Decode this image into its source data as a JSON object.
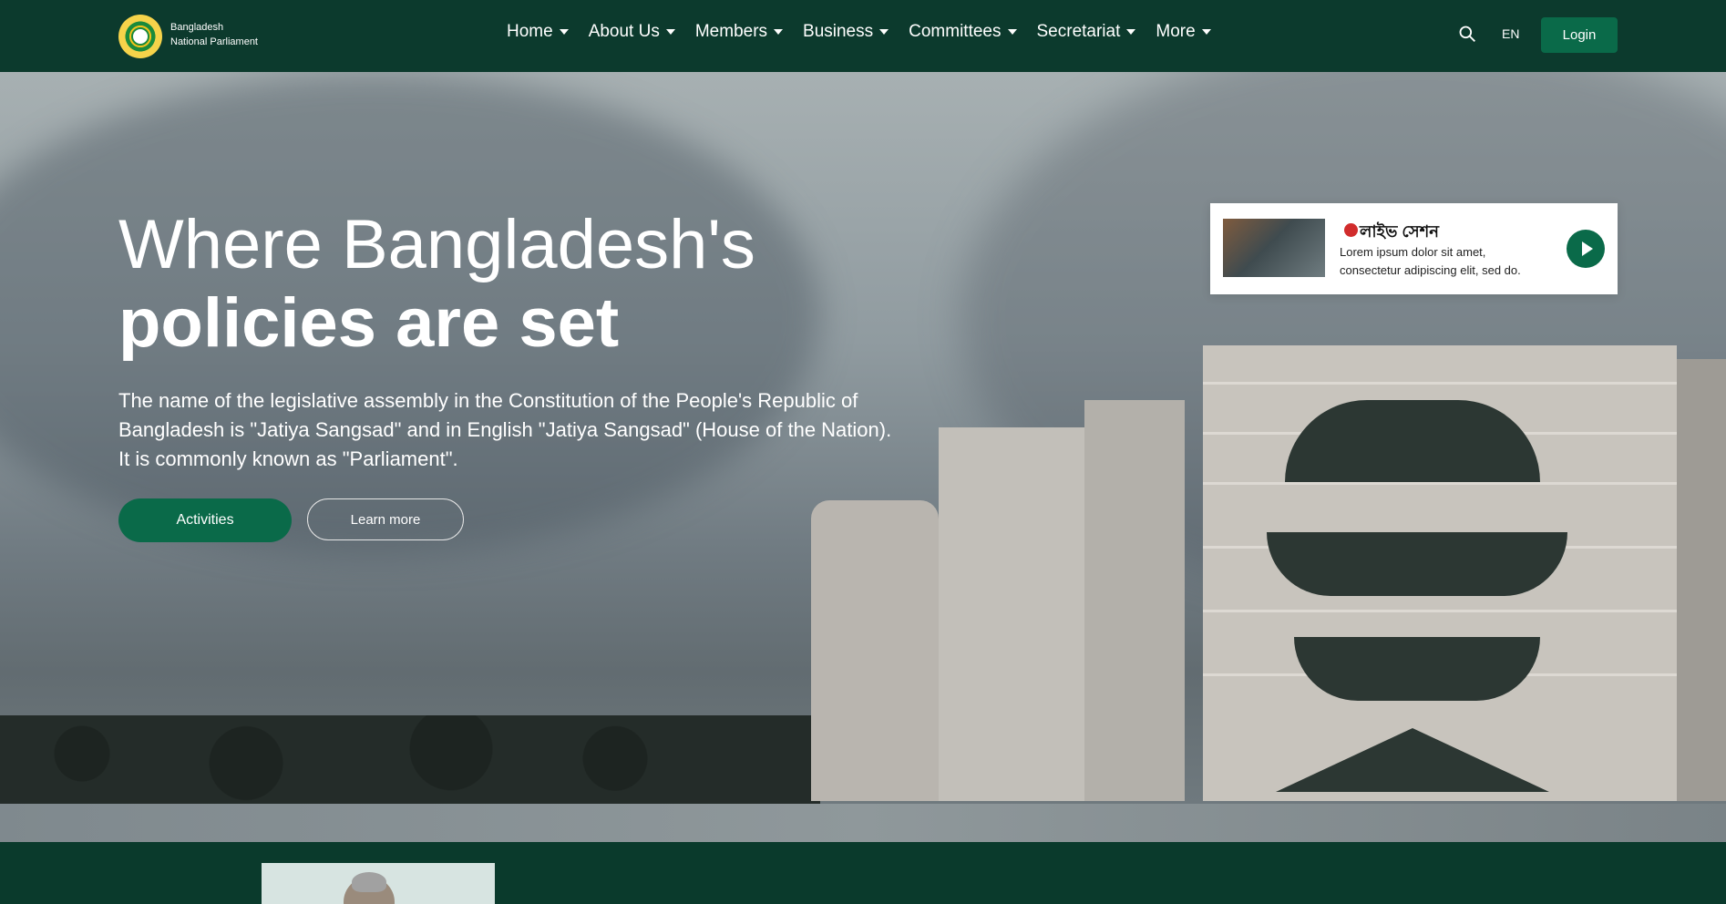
{
  "header": {
    "brand": {
      "line1": "Bangladesh",
      "line2": "National Parliament"
    },
    "nav": [
      {
        "label": "Home"
      },
      {
        "label": "About Us"
      },
      {
        "label": "Members"
      },
      {
        "label": "Business"
      },
      {
        "label": "Committees"
      },
      {
        "label": "Secretariat"
      },
      {
        "label": "More"
      }
    ],
    "language": "EN",
    "login": "Login"
  },
  "hero": {
    "title_line1": "Where Bangladesh's",
    "title_line2": "policies are set",
    "description": "The name of the legislative assembly in the Constitution of the People's Republic of Bangladesh is \"Jatiya Sangsad\" and in English \"Jatiya Sangsad\" (House of the Nation). It is commonly known as \"Parliament\".",
    "primary_button": "Activities",
    "secondary_button": "Learn more"
  },
  "live_card": {
    "title": "লাইভ সেশন",
    "text": "Lorem ipsum dolor sit amet, consectetur adipiscing elit, sed do."
  },
  "colors": {
    "header_bg": "#0c3a2d",
    "accent": "#0a6a49",
    "live_dot": "#d12c2c"
  },
  "icons": {
    "logo": "parliament-seal-icon",
    "search": "search-icon",
    "play": "play-icon"
  }
}
